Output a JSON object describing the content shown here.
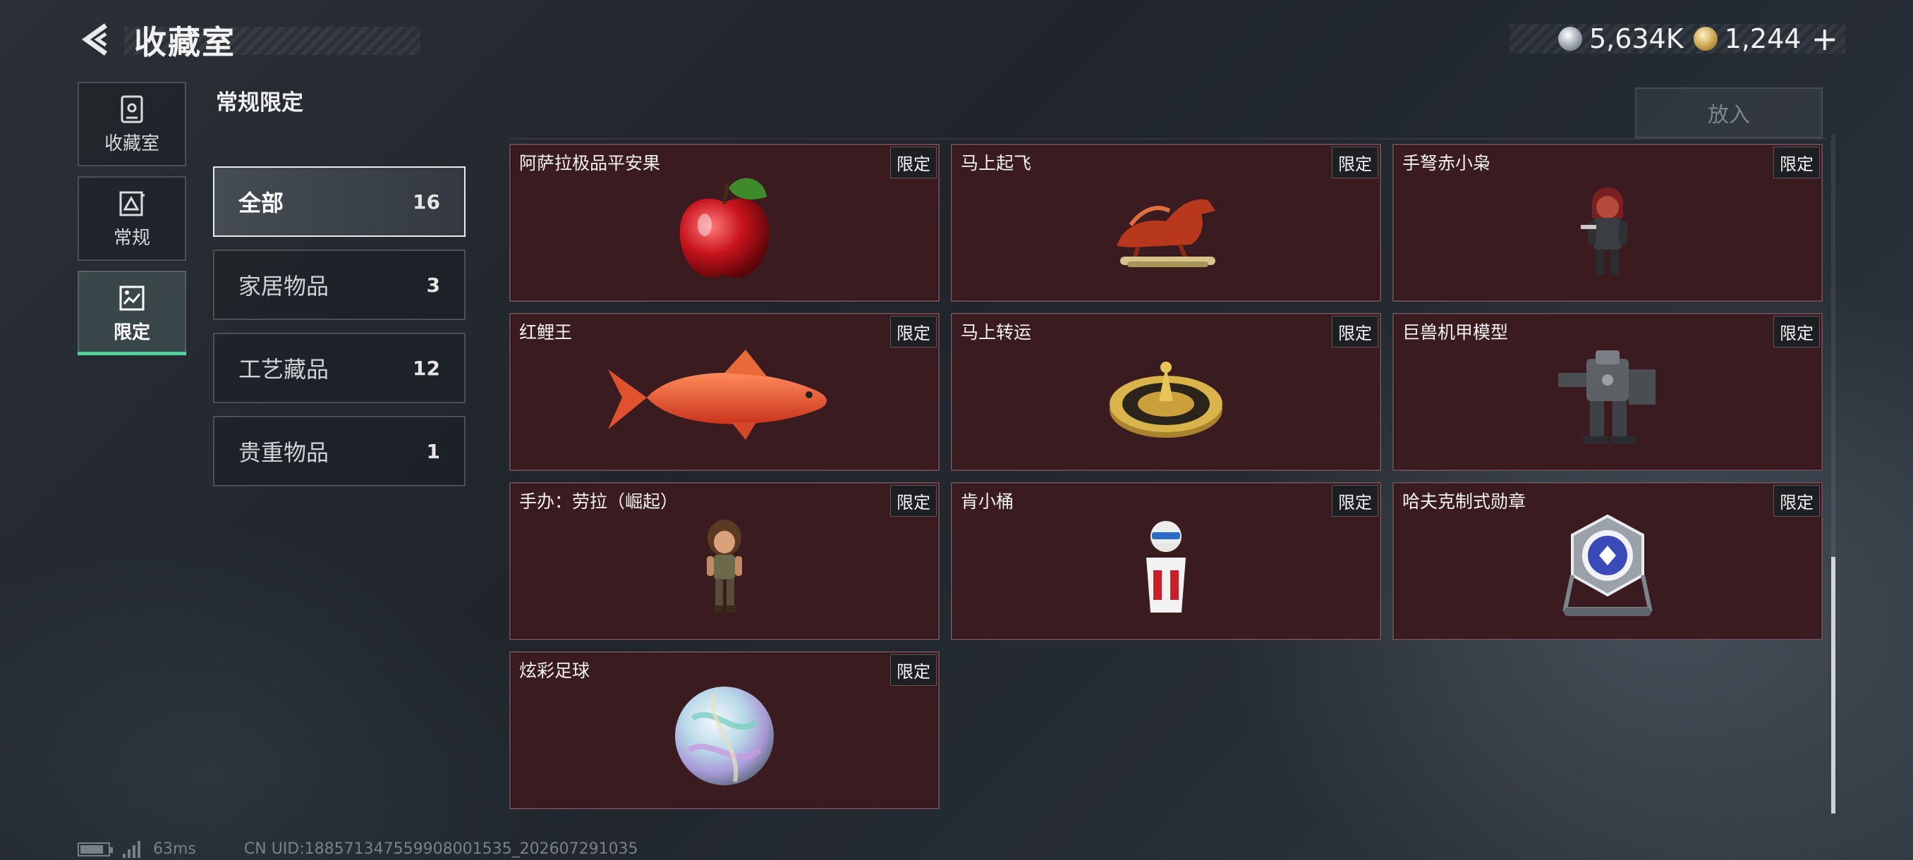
{
  "header": {
    "title": "收藏室",
    "currency": [
      {
        "icon": "silver-coin-icon",
        "value": "5,634K"
      },
      {
        "icon": "gold-coin-icon",
        "value": "1,244"
      }
    ],
    "plus_label": "+"
  },
  "nav": {
    "items": [
      {
        "label": "收藏室",
        "icon": "collection-room-icon"
      },
      {
        "label": "常规",
        "icon": "regular-icon"
      },
      {
        "label": "限定",
        "icon": "limited-icon",
        "active": true
      }
    ]
  },
  "section": {
    "title": "常规限定",
    "put_button": "放入"
  },
  "categories": [
    {
      "label": "全部",
      "count": "16",
      "active": true
    },
    {
      "label": "家居物品",
      "count": "3"
    },
    {
      "label": "工艺藏品",
      "count": "12"
    },
    {
      "label": "贵重物品",
      "count": "1"
    }
  ],
  "items": [
    {
      "name": "阿萨拉极品平安果",
      "tag": "限定",
      "icon": "apple-icon"
    },
    {
      "name": "马上起飞",
      "tag": "限定",
      "icon": "horse-statue-icon"
    },
    {
      "name": "手弩赤小枭",
      "tag": "限定",
      "icon": "hooded-figure-icon"
    },
    {
      "name": "红鲤王",
      "tag": "限定",
      "icon": "carp-fish-icon"
    },
    {
      "name": "马上转运",
      "tag": "限定",
      "icon": "golden-compass-icon"
    },
    {
      "name": "巨兽机甲模型",
      "tag": "限定",
      "icon": "mech-model-icon"
    },
    {
      "name": "手办：劳拉（崛起）",
      "tag": "限定",
      "icon": "lara-figure-icon"
    },
    {
      "name": "肯小桶",
      "tag": "限定",
      "icon": "colonel-bucket-icon"
    },
    {
      "name": "哈夫克制式勋章",
      "tag": "限定",
      "icon": "medal-icon"
    },
    {
      "name": "炫彩足球",
      "tag": "限定",
      "icon": "iridescent-ball-icon"
    }
  ],
  "footer": {
    "ping": "63ms",
    "uid": "CN UID:18857134755990800153​5_202607291035"
  },
  "colors": {
    "card_bg": "#3a1b20",
    "active_accent": "#4fd39a"
  }
}
